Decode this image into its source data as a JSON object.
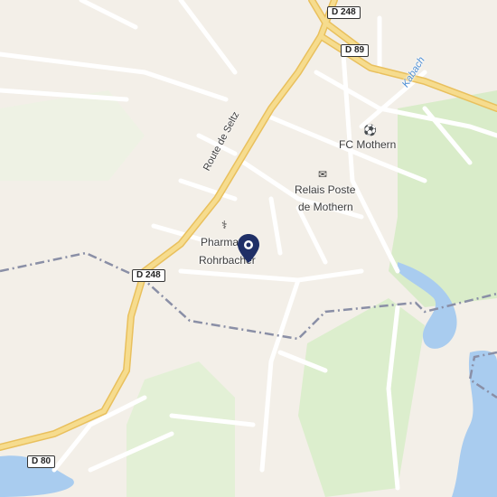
{
  "map": {
    "labels": {
      "fc_mothern": "FC Mothern",
      "relais_poste_line1": "Relais Poste",
      "relais_poste_line2": "de Mothern",
      "pharmacie_line1": "Pharma",
      "pharmacie_line2": "Rohrbacher",
      "route_de_seltz": "Route de Seltz",
      "kabach": "Kabach"
    },
    "road_shields": {
      "d248_top": "D 248",
      "d89": "D 89",
      "d248_left": "D 248",
      "d80": "D 80"
    },
    "colors": {
      "land": "#f3efe8",
      "green": "#d9ecc9",
      "water": "#a9ccef",
      "major_road": "#f2d27a",
      "minor_road": "#ffffff",
      "boundary": "#8a8fa6",
      "pin": "#1f2f66"
    },
    "icons": {
      "poi_soccer": "soccer-ball-icon",
      "poi_post": "envelope-icon",
      "poi_pharmacy": "pharmacy-icon",
      "location_pin": "map-pin-icon"
    }
  }
}
